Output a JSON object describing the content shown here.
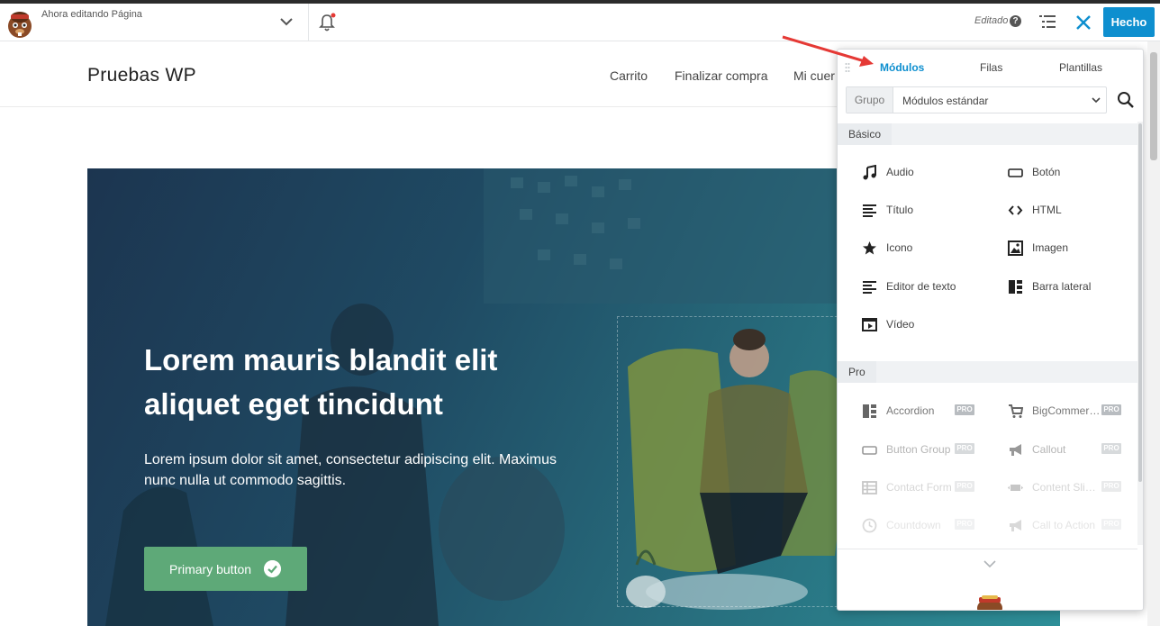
{
  "topbar": {
    "editing_label": "Ahora editando Página",
    "status": "Editado",
    "done_label": "Hecho"
  },
  "site": {
    "title": "Pruebas WP",
    "nav": [
      "Carrito",
      "Finalizar compra",
      "Mi cuer"
    ]
  },
  "hero": {
    "title_line1": "Lorem mauris blandit elit",
    "title_line2": "aliquet eget tincidunt",
    "text_line1": "Lorem ipsum dolor sit amet, consectetur adipiscing elit. Maximus",
    "text_line2": "nunc nulla ut commodo sagittis.",
    "button_label": "Primary button"
  },
  "panel": {
    "tabs": [
      "Módulos",
      "Filas",
      "Plantillas"
    ],
    "active_tab": "Módulos",
    "group_label": "Grupo",
    "group_value": "Módulos estándar",
    "sections": {
      "basic": "Básico",
      "pro": "Pro"
    },
    "basic_modules": [
      {
        "label": "Audio",
        "icon": "music-icon"
      },
      {
        "label": "Botón",
        "icon": "button-icon"
      },
      {
        "label": "Título",
        "icon": "heading-icon"
      },
      {
        "label": "HTML",
        "icon": "code-icon"
      },
      {
        "label": "Icono",
        "icon": "star-icon"
      },
      {
        "label": "Imagen",
        "icon": "image-icon"
      },
      {
        "label": "Editor de texto",
        "icon": "text-editor-icon"
      },
      {
        "label": "Barra lateral",
        "icon": "sidebar-icon"
      },
      {
        "label": "Vídeo",
        "icon": "video-icon"
      }
    ],
    "pro_badge": "PRO",
    "pro_modules": [
      {
        "label": "Accordion",
        "icon": "accordion-icon"
      },
      {
        "label": "BigCommer…",
        "icon": "cart-icon"
      },
      {
        "label": "Button Group",
        "icon": "button-icon"
      },
      {
        "label": "Callout",
        "icon": "megaphone-icon"
      },
      {
        "label": "Contact Form",
        "icon": "table-icon"
      },
      {
        "label": "Content Sli…",
        "icon": "slider-icon"
      },
      {
        "label": "Countdown",
        "icon": "clock-icon"
      },
      {
        "label": "Call to Action",
        "icon": "megaphone-icon"
      }
    ]
  },
  "colors": {
    "accent": "#0e8fcf",
    "hero_button": "#5ea978",
    "arrow": "#e53935"
  }
}
